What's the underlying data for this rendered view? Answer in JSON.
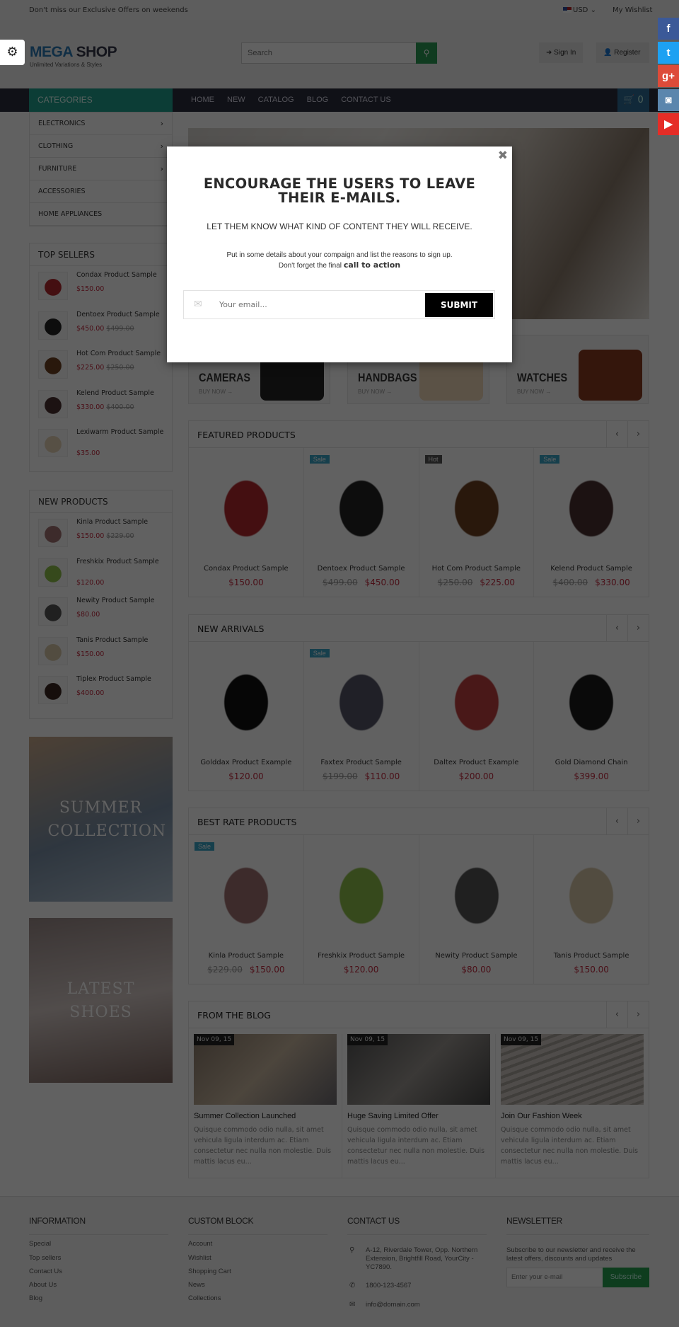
{
  "topbar": {
    "promo": "Don't miss our Exclusive Offers on weekends",
    "currency": "USD",
    "wishlist": "My Wishlist"
  },
  "header": {
    "logo_mega": "MEGA",
    "logo_shop": " SHOP",
    "tagline": "Unlimited Variations & Styles",
    "search_placeholder": "Search",
    "sign_in": "Sign In",
    "register": "Register"
  },
  "nav": {
    "categories": "CATEGORIES",
    "menu": [
      "HOME",
      "NEW",
      "CATALOG",
      "BLOG",
      "CONTACT US"
    ],
    "cart_count": "0"
  },
  "categories": [
    "ELECTRONICS",
    "CLOTHING",
    "FURNITURE",
    "ACCESSORIES",
    "HOME APPLIANCES"
  ],
  "categories_with_submenu": [
    true,
    true,
    true,
    false,
    false
  ],
  "top_sellers": {
    "title": "TOP SELLERS",
    "items": [
      {
        "name": "Condax Product Sample",
        "price": "$150.00",
        "old": "",
        "color": "#b3282d"
      },
      {
        "name": "Dentoex Product Sample",
        "price": "$450.00",
        "old": "$499.00",
        "color": "#222"
      },
      {
        "name": "Hot Com Product Sample",
        "price": "$225.00",
        "old": "$250.00",
        "color": "#6b3e1f"
      },
      {
        "name": "Kelend Product Sample",
        "price": "$330.00",
        "old": "$400.00",
        "color": "#4a3030"
      },
      {
        "name": "Lexiwarm Product Sample",
        "price": "$35.00",
        "old": "",
        "color": "#e6d2b5"
      }
    ]
  },
  "new_products": {
    "title": "NEW PRODUCTS",
    "items": [
      {
        "name": "Kinla Product Sample",
        "price": "$150.00",
        "old": "$229.00",
        "color": "#a07070"
      },
      {
        "name": "Freshkix Product Sample",
        "price": "$120.00",
        "old": "",
        "color": "#8fc04a"
      },
      {
        "name": "Newity Product Sample",
        "price": "$80.00",
        "old": "",
        "color": "#555"
      },
      {
        "name": "Tanis Product Sample",
        "price": "$150.00",
        "old": "",
        "color": "#d8c8a8"
      },
      {
        "name": "Tiplex Product Sample",
        "price": "$400.00",
        "old": "",
        "color": "#3a2520"
      }
    ]
  },
  "side_banners": [
    {
      "text": "SUMMER COLLECTION"
    },
    {
      "text": "LATEST SHOES"
    }
  ],
  "banners": [
    {
      "title": "CAMERAS",
      "cta": "BUY NOW →",
      "color": "#222"
    },
    {
      "title": "HANDBAGS",
      "cta": "BUY NOW →",
      "color": "#f0d8b8"
    },
    {
      "title": "WATCHES",
      "cta": "BUY NOW →",
      "color": "#8a3a20"
    }
  ],
  "sections": [
    {
      "title": "FEATURED PRODUCTS",
      "products": [
        {
          "name": "Condax Product Sample",
          "price": "$150.00",
          "old": "",
          "badge": "",
          "color": "#b3282d"
        },
        {
          "name": "Dentoex Product Sample",
          "price": "$450.00",
          "old": "$499.00",
          "badge": "Sale",
          "color": "#222"
        },
        {
          "name": "Hot Com Product Sample",
          "price": "$225.00",
          "old": "$250.00",
          "badge": "Hot",
          "color": "#6b3e1f"
        },
        {
          "name": "Kelend Product Sample",
          "price": "$330.00",
          "old": "$400.00",
          "badge": "Sale",
          "color": "#4a3030"
        }
      ]
    },
    {
      "title": "NEW ARRIVALS",
      "products": [
        {
          "name": "Golddax Product Example",
          "price": "$120.00",
          "old": "",
          "badge": "",
          "color": "#111"
        },
        {
          "name": "Faxtex Product Sample",
          "price": "$110.00",
          "old": "$199.00",
          "badge": "Sale",
          "color": "#556"
        },
        {
          "name": "Daltex Product Example",
          "price": "$200.00",
          "old": "",
          "badge": "",
          "color": "#c04040"
        },
        {
          "name": "Gold Diamond Chain",
          "price": "$399.00",
          "old": "",
          "badge": "",
          "color": "#1a1a1a"
        }
      ]
    },
    {
      "title": "BEST RATE PRODUCTS",
      "products": [
        {
          "name": "Kinla Product Sample",
          "price": "$150.00",
          "old": "$229.00",
          "badge": "Sale",
          "color": "#a07070"
        },
        {
          "name": "Freshkix Product Sample",
          "price": "$120.00",
          "old": "",
          "badge": "",
          "color": "#8fc04a"
        },
        {
          "name": "Newity Product Sample",
          "price": "$80.00",
          "old": "",
          "badge": "",
          "color": "#555"
        },
        {
          "name": "Tanis Product Sample",
          "price": "$150.00",
          "old": "",
          "badge": "",
          "color": "#d8c8a8"
        }
      ]
    }
  ],
  "blog": {
    "title": "FROM THE BLOG",
    "posts": [
      {
        "date": "Nov 09, 15",
        "title": "Summer Collection Launched",
        "excerpt": "Quisque commodo odio nulla, sit amet vehicula ligula interdum ac. Etiam consectetur nec nulla non molestie. Duis mattis lacus eu..."
      },
      {
        "date": "Nov 09, 15",
        "title": "Huge Saving Limited Offer",
        "excerpt": "Quisque commodo odio nulla, sit amet vehicula ligula interdum ac. Etiam consectetur nec nulla non molestie. Duis mattis lacus eu..."
      },
      {
        "date": "Nov 09, 15",
        "title": "Join Our Fashion Week",
        "excerpt": "Quisque commodo odio nulla, sit amet vehicula ligula interdum ac. Etiam consectetur nec nulla non molestie. Duis mattis lacus eu..."
      }
    ]
  },
  "footer": {
    "information": {
      "title": "INFORMATION",
      "links": [
        "Special",
        "Top sellers",
        "Contact Us",
        "About Us",
        "Blog"
      ]
    },
    "custom": {
      "title": "CUSTOM BLOCK",
      "links": [
        "Account",
        "Wishlist",
        "Shopping Cart",
        "News",
        "Collections"
      ]
    },
    "contact": {
      "title": "CONTACT US",
      "address": "A-12, Riverdale Tower, Opp. Northern Extension, Brightfill Road, YourCity - YC7890.",
      "phone": "1800-123-4567",
      "email": "info@domain.com"
    },
    "newsletter": {
      "title": "NEWSLETTER",
      "text": "Subscribe to our newsletter and receive the latest offers, discounts and updates",
      "placeholder": "Enter your e-mail",
      "button": "Subscribe"
    }
  },
  "modal": {
    "title": "ENCOURAGE THE USERS TO LEAVE THEIR E-MAILS.",
    "subtitle": "LET THEM KNOW WHAT KIND OF CONTENT THEY WILL RECEIVE.",
    "body1": "Put in some details about your compaign and list the reasons to sign up.",
    "body2": "Don't forget the final ",
    "body2_bold": "call to action",
    "placeholder": "Your email...",
    "submit": "SUBMIT"
  },
  "colors": {
    "accent_teal": "#1fa08d",
    "price_red": "#c42a3f",
    "sale_badge": "#3ba6c9",
    "hot_badge": "#555555",
    "search_green": "#2a9a53",
    "nav_bg": "#2b2d3c"
  },
  "social": [
    {
      "icon": "facebook-icon",
      "glyph": "f",
      "color": "#3b5998"
    },
    {
      "icon": "twitter-icon",
      "glyph": "t",
      "color": "#1da1f2"
    },
    {
      "icon": "google-plus-icon",
      "glyph": "g+",
      "color": "#dd4b39"
    },
    {
      "icon": "instagram-icon",
      "glyph": "◙",
      "color": "#5b86ad"
    },
    {
      "icon": "youtube-icon",
      "glyph": "▶",
      "color": "#e52d27"
    }
  ]
}
